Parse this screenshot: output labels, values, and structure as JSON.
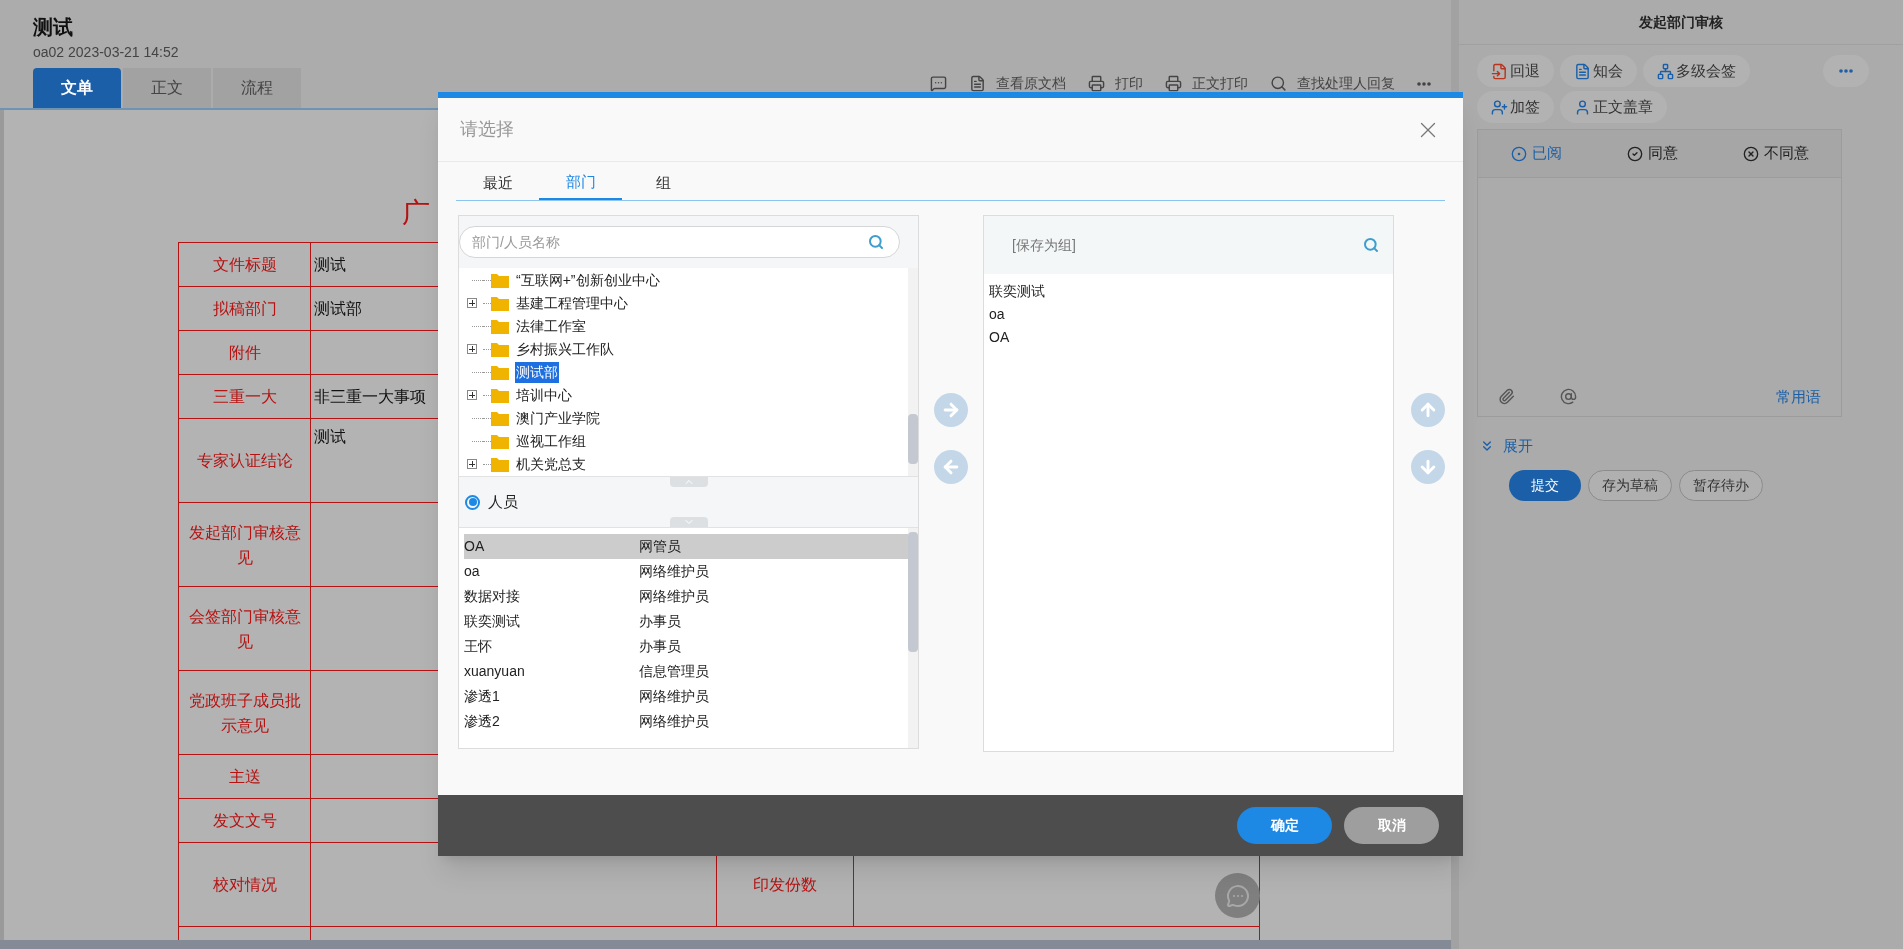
{
  "document": {
    "title": "测试",
    "meta": "oa02 2023-03-21 14:52",
    "tabs": [
      {
        "label": "文单",
        "selected": true
      },
      {
        "label": "正文",
        "selected": false
      },
      {
        "label": "流程",
        "selected": false
      }
    ],
    "toolbar": [
      {
        "kind": "comment"
      },
      {
        "kind": "document",
        "label": "查看原文档"
      },
      {
        "kind": "print",
        "label": "打印"
      },
      {
        "kind": "print",
        "label": "正文打印"
      },
      {
        "kind": "search",
        "label": "查找处理人回复"
      },
      {
        "kind": "more"
      }
    ],
    "heading": "广",
    "rows": [
      {
        "label": "文件标题",
        "value": "测试",
        "tall": false
      },
      {
        "label": "拟稿部门",
        "value": "测试部",
        "tall": false
      },
      {
        "label": "附件",
        "tall": false
      },
      {
        "label": "三重一大",
        "value": "非三重一大事项",
        "tall": false
      },
      {
        "label": "专家认证结论",
        "value": "测试",
        "tall": true
      },
      {
        "label": "发起部门审核意见",
        "tall": true
      },
      {
        "label": "会签部门审核意见",
        "tall": true
      },
      {
        "label": "党政班子成员批示意见",
        "tall": true
      },
      {
        "label": "主送",
        "tall": false
      },
      {
        "label": "发文文号",
        "tall": false
      },
      {
        "label": "校对情况",
        "extra_label": "印发份数",
        "tall": true
      }
    ]
  },
  "side_panel": {
    "title": "发起部门审核",
    "actions": [
      {
        "kind": "return",
        "label": "回退"
      },
      {
        "kind": "notify",
        "label": "知会"
      },
      {
        "kind": "multi",
        "label": "多级会签"
      },
      {
        "kind": "more"
      },
      {
        "kind": "add",
        "label": "加签"
      },
      {
        "kind": "stamp",
        "label": "正文盖章"
      }
    ],
    "opinion_tabs": [
      {
        "kind": "read",
        "label": "已阅",
        "selected": true
      },
      {
        "kind": "agree",
        "label": "同意",
        "selected": false
      },
      {
        "kind": "disagree",
        "label": "不同意",
        "selected": false
      }
    ],
    "phrases": "常用语",
    "expand": "展开",
    "buttons": [
      {
        "label": "提交",
        "primary": true
      },
      {
        "label": "存为草稿",
        "primary": false
      },
      {
        "label": "暂存待办",
        "primary": false
      }
    ]
  },
  "dialog": {
    "title": "请选择",
    "tabs": [
      {
        "label": "最近",
        "selected": false
      },
      {
        "label": "部门",
        "selected": true
      },
      {
        "label": "组",
        "selected": false
      }
    ],
    "search": {
      "placeholder": "部门/人员名称"
    },
    "tree": [
      {
        "label": "“互联网+”创新创业中心",
        "has_children": false,
        "selected": false
      },
      {
        "label": "基建工程管理中心",
        "has_children": true,
        "selected": false
      },
      {
        "label": "法律工作室",
        "has_children": false,
        "selected": false
      },
      {
        "label": "乡村振兴工作队",
        "has_children": true,
        "selected": false
      },
      {
        "label": "测试部",
        "has_children": false,
        "selected": true
      },
      {
        "label": "培训中心",
        "has_children": true,
        "selected": false
      },
      {
        "label": "澳门产业学院",
        "has_children": false,
        "selected": false
      },
      {
        "label": "巡视工作组",
        "has_children": false,
        "selected": false
      },
      {
        "label": "机关党总支",
        "has_children": true,
        "selected": false
      }
    ],
    "people_option": {
      "label": "人员",
      "selected": true
    },
    "people": [
      {
        "name": "OA",
        "role": "网管员",
        "selected": true
      },
      {
        "name": "oa",
        "role": "网络维护员",
        "selected": false
      },
      {
        "name": "数据对接",
        "role": "网络维护员",
        "selected": false
      },
      {
        "name": "联奕测试",
        "role": "办事员",
        "selected": false
      },
      {
        "name": "王怀",
        "role": "办事员",
        "selected": false
      },
      {
        "name": "xuanyuan",
        "role": "信息管理员",
        "selected": false
      },
      {
        "name": "渗透1",
        "role": "网络维护员",
        "selected": false
      },
      {
        "name": "渗透2",
        "role": "网络维护员",
        "selected": false
      }
    ],
    "chosen": {
      "header": "[保存为组]",
      "items": [
        "联奕测试",
        "oa",
        "OA"
      ]
    },
    "buttons": [
      {
        "label": "确定",
        "kind": "primary"
      },
      {
        "label": "取消",
        "kind": "secondary"
      }
    ]
  }
}
